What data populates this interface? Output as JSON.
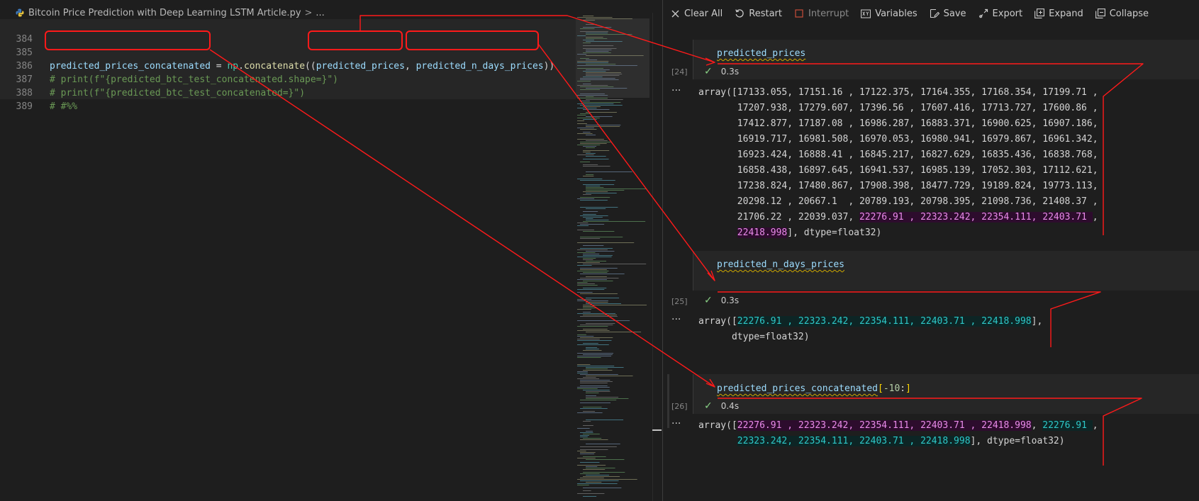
{
  "editor": {
    "file_title": "Bitcoin Price Prediction with Deep Learning LSTM Article.py",
    "breadcrumb_sep": ">",
    "breadcrumb_more": "...",
    "lines": [
      {
        "num": "384",
        "code": ""
      },
      {
        "num": "385"
      },
      {
        "num": "386",
        "code": "# print(f\"{predicted_btc_test_concatenated.shape=}\")"
      },
      {
        "num": "387",
        "code": "# print(f\"{predicted_btc_test_concatenated=}\")"
      },
      {
        "num": "388",
        "code": "# #%%"
      },
      {
        "num": "389",
        "code": ""
      }
    ],
    "line385": {
      "target": "predicted_prices_concatenated",
      "eq": " = ",
      "module": "np",
      "dot": ".",
      "func": "concatenate",
      "open": "((",
      "arg1": "predicted_prices",
      "comma": ", ",
      "arg2": "predicted_n_days_prices",
      "close": "))"
    }
  },
  "toolbar": {
    "clear_all": "Clear All",
    "restart": "Restart",
    "interrupt": "Interrupt",
    "variables": "Variables",
    "save": "Save",
    "export": "Export",
    "expand": "Expand",
    "collapse": "Collapse"
  },
  "cells": [
    {
      "exec_count": "[24]",
      "input": "predicted_prices",
      "time": "0.3s",
      "output_lines": [
        "array([17133.055, 17151.16 , 17122.375, 17164.355, 17168.354, 17199.71 ,",
        "       17207.938, 17279.607, 17396.56 , 17607.416, 17713.727, 17600.86 ,",
        "       17412.877, 17187.08 , 16986.287, 16883.371, 16900.625, 16907.186,",
        "       16919.717, 16981.508, 16970.053, 16980.941, 16979.867, 16961.342,",
        "       16923.424, 16888.41 , 16845.217, 16827.629, 16835.436, 16838.768,",
        "       16858.438, 16897.645, 16941.537, 16985.139, 17052.303, 17112.621,",
        "       17238.824, 17480.867, 17908.398, 18477.729, 19189.824, 19773.113,",
        "       20298.12 , 20667.1  , 20789.193, 20798.395, 21098.736, 21408.37 ,"
      ],
      "line9_pre": "       21706.22 , 22039.037, ",
      "line9_hl": "22276.91 , 22323.242, 22354.111, 22403.71 ",
      "line9_post": ",",
      "line10_pre": "       ",
      "line10_hl": "22418.998",
      "line10_post": "], dtype=float32)"
    },
    {
      "exec_count": "[25]",
      "input": "predicted_n_days_prices",
      "time": "0.3s",
      "o1_pre": "array([",
      "o1_hl": "22276.91 , 22323.242, 22354.111, 22403.71 , 22418.998",
      "o1_post": "],",
      "o2": "      dtype=float32)"
    },
    {
      "exec_count": "[26]",
      "input_name": "predicted_prices_concatenated",
      "input_open": "[",
      "input_num": "-10",
      "input_colon": ":",
      "input_close": "]",
      "time": "0.4s",
      "o1_pre": "array([",
      "o1_hl_purple": "22276.91 , 22323.242, 22354.111, 22403.71 , 22418.998",
      "o1_mid": ", ",
      "o1_hl_cyan": "22276.91 ",
      "o1_post": ",",
      "o2_pre": "       ",
      "o2_hl_cyan": "22323.242, 22354.111, 22403.71 , 22418.998",
      "o2_post": "], dtype=float32)"
    }
  ],
  "output_dots": "···",
  "colors": {
    "annotation": "#ff1a1a",
    "highlight_purple": "#e98bea",
    "highlight_cyan": "#2ec8c8"
  }
}
